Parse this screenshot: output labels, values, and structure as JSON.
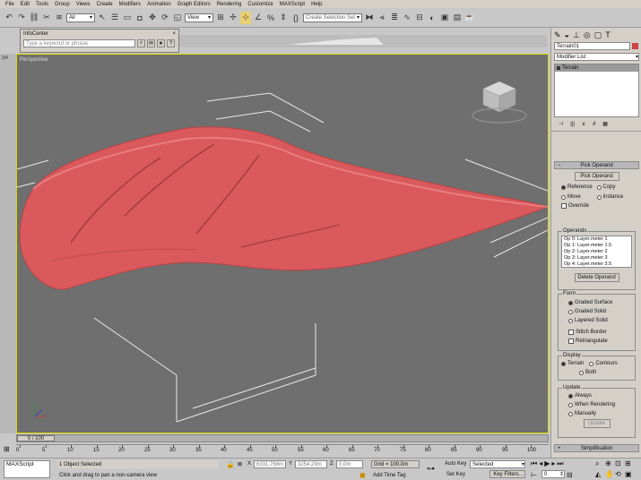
{
  "menu": [
    "File",
    "Edit",
    "Tools",
    "Group",
    "Views",
    "Create",
    "Modifiers",
    "Animation",
    "Graph Editors",
    "Rendering",
    "Customize",
    "MAXScript",
    "Help"
  ],
  "toolbar": {
    "filter_value": "All",
    "view_value": "View",
    "selection_set_placeholder": "Create Selection Set"
  },
  "infocenter": {
    "title": "InfoCenter",
    "search_placeholder": "Type a keyword or phrase"
  },
  "viewport": {
    "label": "Perspective",
    "lefttool_label": "3/4"
  },
  "command_panel": {
    "object_name": "Terrain01",
    "modifier_list_label": "Modifier List",
    "stack_item": "Terrain",
    "pick_rollout_title": "Pick Operand",
    "pick_button": "Pick Operand",
    "ref_options": [
      "Reference",
      "Copy",
      "Move",
      "Instance"
    ],
    "override_label": "Override",
    "operands_label": "Operands",
    "operands": [
      "Op 0: Layer.meter 1",
      "Op 1: Layer.meter 1.5",
      "Op 2: Layer.meter 2",
      "Op 3: Layer.meter 3",
      "Op 4: Layer.meter 3.5"
    ],
    "delete_operand": "Delete Operand",
    "form_label": "Form",
    "form_options": [
      "Graded Surface",
      "Graded Solid",
      "Layered Solid"
    ],
    "stitch_border": "Stitch Border",
    "retriangulate": "Retriangulate",
    "display_label": "Display",
    "display_options": [
      "Terrain",
      "Contours",
      "Both"
    ],
    "update_label": "Update",
    "update_options": [
      "Always",
      "When Rendering",
      "Manually"
    ],
    "update_button": "Update",
    "simplification": "Simplification"
  },
  "timeline": {
    "frame_display": "0 / 100",
    "ticks": [
      "0",
      "5",
      "10",
      "15",
      "20",
      "25",
      "30",
      "35",
      "40",
      "45",
      "50",
      "55",
      "60",
      "65",
      "70",
      "75",
      "80",
      "85",
      "90",
      "95",
      "100"
    ]
  },
  "status": {
    "maxscript": "MAXScript",
    "objects_selected": "1 Object Selected",
    "prompt": "Click and drag to pan a non-camera view",
    "x_label": "X",
    "x_value": "6331,768m",
    "y_label": "Y",
    "y_value": "3254,29m",
    "z_label": "Z",
    "z_value": "0,0m",
    "grid": "Grid = 100,0m",
    "add_time_tag": "Add Time Tag",
    "auto_key": "Auto Key",
    "selected_value": "Selected",
    "set_key": "Set Key",
    "key_filters": "Key Filters...",
    "frame_value": "0"
  },
  "colors": {
    "terrain": "#d9595c",
    "viewport_bg": "#6f6f6f",
    "active_border": "#d8d800"
  }
}
